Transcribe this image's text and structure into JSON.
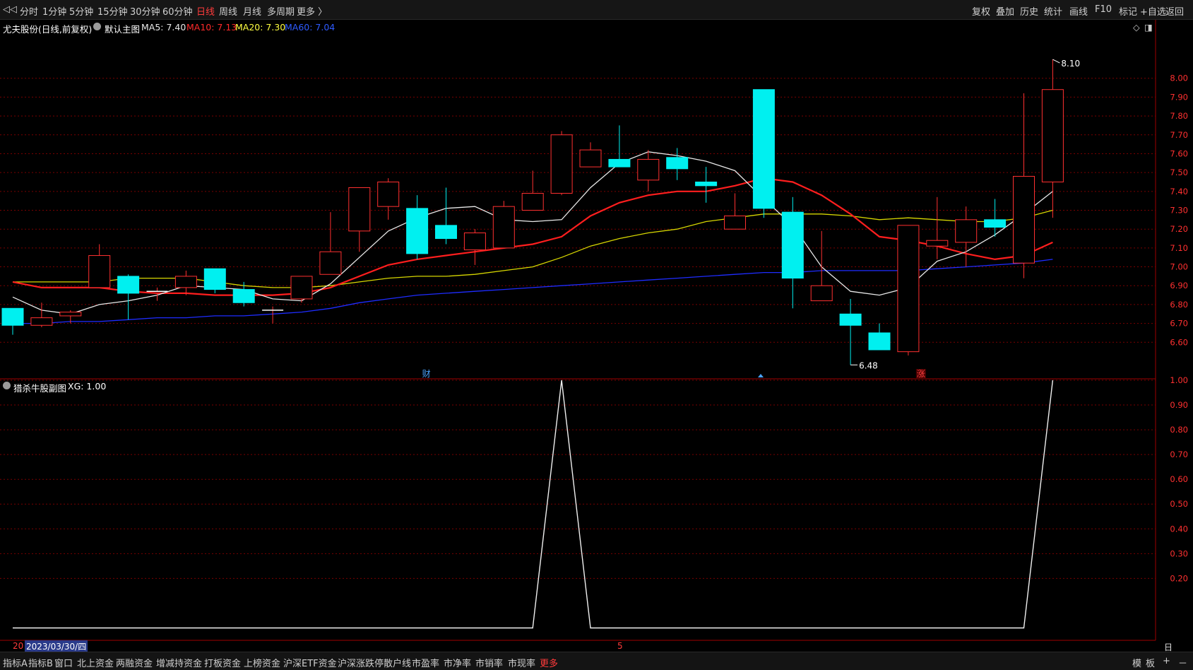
{
  "toolbar": {
    "left": [
      "分时",
      "1分钟",
      "5分钟",
      "15分钟",
      "30分钟",
      "60分钟",
      "日线",
      "周线",
      "月线",
      "多周期",
      "更多 〉"
    ],
    "active": "日线",
    "right": [
      "复权",
      "叠加",
      "历史",
      "统计",
      "画线",
      "F10",
      "标记",
      "+自选",
      "返回"
    ]
  },
  "info": {
    "stock": "尤夫股份(日线,前复权)",
    "main_label": "默认主图",
    "ma5": "MA5: 7.40",
    "ma10": "MA10: 7.13",
    "ma20": "MA20: 7.30",
    "ma60": "MA60: 7.04"
  },
  "sub_info": {
    "name": "猎杀牛股副图",
    "xg": "XG: 1.00"
  },
  "date_axis": {
    "prefix": "20",
    "cursor_date": "2023/03/30/四",
    "mid_label": "5",
    "period": "日线"
  },
  "bottom": {
    "left": [
      "指标A",
      "指标B",
      "窗口",
      "北上资金",
      "两融资金",
      "增减持资金",
      "打板资金",
      "上榜资金",
      "沪深ETF资金",
      "沪深涨跌停",
      "散户线",
      "市盈率",
      "市净率",
      "市销率",
      "市现率",
      "更多"
    ],
    "right": [
      "模",
      "板",
      "+",
      "－"
    ]
  },
  "chart_data": [
    {
      "type": "candlestick",
      "title": "尤夫股份(日线,前复权)",
      "y_ticks": [
        "8.00",
        "7.90",
        "7.80",
        "7.70",
        "7.60",
        "7.50",
        "7.40",
        "7.30",
        "7.20",
        "7.10",
        "7.00",
        "6.90",
        "6.80",
        "6.70",
        "6.60"
      ],
      "ylim": [
        6.41,
        8.22
      ],
      "annotations": {
        "high": "8.10",
        "low": "6.48",
        "markers": [
          "财",
          "涨"
        ]
      },
      "ohlc": [
        [
          6.78,
          6.78,
          6.64,
          6.69
        ],
        [
          6.69,
          6.81,
          6.68,
          6.73
        ],
        [
          6.74,
          6.77,
          6.7,
          6.76
        ],
        [
          6.89,
          7.12,
          6.89,
          7.06
        ],
        [
          6.95,
          6.96,
          6.72,
          6.86
        ],
        [
          6.86,
          6.89,
          6.82,
          6.87
        ],
        [
          6.89,
          6.98,
          6.85,
          6.95
        ],
        [
          6.99,
          6.99,
          6.86,
          6.88
        ],
        [
          6.88,
          6.92,
          6.79,
          6.81
        ],
        [
          6.77,
          6.79,
          6.7,
          6.77
        ],
        [
          6.83,
          6.95,
          6.81,
          6.95
        ],
        [
          6.96,
          7.29,
          6.96,
          7.08
        ],
        [
          7.19,
          7.42,
          7.08,
          7.42
        ],
        [
          7.32,
          7.47,
          7.25,
          7.45
        ],
        [
          7.31,
          7.38,
          7.04,
          7.07
        ],
        [
          7.22,
          7.42,
          7.12,
          7.15
        ],
        [
          7.09,
          7.2,
          7.01,
          7.18
        ],
        [
          7.1,
          7.35,
          7.1,
          7.32
        ],
        [
          7.3,
          7.51,
          7.3,
          7.39
        ],
        [
          7.39,
          7.72,
          7.38,
          7.7
        ],
        [
          7.53,
          7.66,
          7.53,
          7.62
        ],
        [
          7.57,
          7.75,
          7.53,
          7.53
        ],
        [
          7.46,
          7.62,
          7.4,
          7.57
        ],
        [
          7.58,
          7.63,
          7.46,
          7.52
        ],
        [
          7.45,
          7.53,
          7.34,
          7.43
        ],
        [
          7.2,
          7.39,
          7.2,
          7.27
        ],
        [
          7.94,
          7.94,
          7.26,
          7.31
        ],
        [
          7.29,
          7.37,
          6.78,
          6.94
        ],
        [
          6.82,
          7.19,
          6.82,
          6.9
        ],
        [
          6.75,
          6.83,
          6.48,
          6.69
        ],
        [
          6.65,
          6.7,
          6.58,
          6.56
        ],
        [
          6.55,
          7.22,
          6.53,
          7.22
        ],
        [
          7.11,
          7.37,
          7.04,
          7.14
        ],
        [
          7.13,
          7.32,
          7.0,
          7.25
        ],
        [
          7.25,
          7.36,
          7.16,
          7.21
        ],
        [
          7.02,
          7.92,
          6.94,
          7.48
        ],
        [
          7.45,
          8.1,
          7.26,
          7.94
        ]
      ],
      "ma5": [
        6.84,
        6.77,
        6.75,
        6.8,
        6.82,
        6.85,
        6.9,
        6.89,
        6.88,
        6.83,
        6.82,
        6.91,
        7.05,
        7.19,
        7.26,
        7.31,
        7.32,
        7.25,
        7.24,
        7.25,
        7.42,
        7.55,
        7.61,
        7.59,
        7.56,
        7.51,
        7.36,
        7.22,
        7.0,
        6.87,
        6.85,
        6.89,
        7.03,
        7.08,
        7.17,
        7.28,
        7.4
      ],
      "ma10": [
        6.92,
        6.89,
        6.89,
        6.89,
        6.87,
        6.86,
        6.86,
        6.85,
        6.85,
        6.85,
        6.86,
        6.89,
        6.95,
        7.01,
        7.04,
        7.06,
        7.08,
        7.1,
        7.12,
        7.16,
        7.27,
        7.34,
        7.38,
        7.4,
        7.4,
        7.43,
        7.47,
        7.45,
        7.38,
        7.28,
        7.16,
        7.14,
        7.11,
        7.07,
        7.04,
        7.06,
        7.13
      ],
      "ma20": [
        6.92,
        6.92,
        6.92,
        6.92,
        6.94,
        6.94,
        6.94,
        6.92,
        6.9,
        6.89,
        6.89,
        6.9,
        6.92,
        6.94,
        6.95,
        6.95,
        6.96,
        6.98,
        7.0,
        7.05,
        7.11,
        7.15,
        7.18,
        7.2,
        7.24,
        7.26,
        7.28,
        7.28,
        7.28,
        7.27,
        7.25,
        7.26,
        7.25,
        7.24,
        7.24,
        7.26,
        7.3
      ],
      "ma60": [
        6.7,
        6.7,
        6.71,
        6.71,
        6.72,
        6.73,
        6.73,
        6.74,
        6.74,
        6.75,
        6.76,
        6.78,
        6.81,
        6.83,
        6.85,
        6.86,
        6.87,
        6.88,
        6.89,
        6.9,
        6.91,
        6.92,
        6.93,
        6.94,
        6.95,
        6.96,
        6.97,
        6.97,
        6.98,
        6.98,
        6.98,
        6.98,
        6.99,
        7.0,
        7.01,
        7.02,
        7.04
      ]
    },
    {
      "type": "line",
      "title": "猎杀牛股副图",
      "series": [
        {
          "name": "XG",
          "x": [
            0,
            18,
            19,
            20,
            35,
            36
          ],
          "values": [
            0,
            0,
            1,
            0,
            0,
            1
          ]
        }
      ],
      "y_ticks": [
        "1.00",
        "0.90",
        "0.80",
        "0.70",
        "0.60",
        "0.50",
        "0.40",
        "0.30",
        "0.20"
      ],
      "ylim": [
        -0.05,
        1.0
      ]
    }
  ]
}
